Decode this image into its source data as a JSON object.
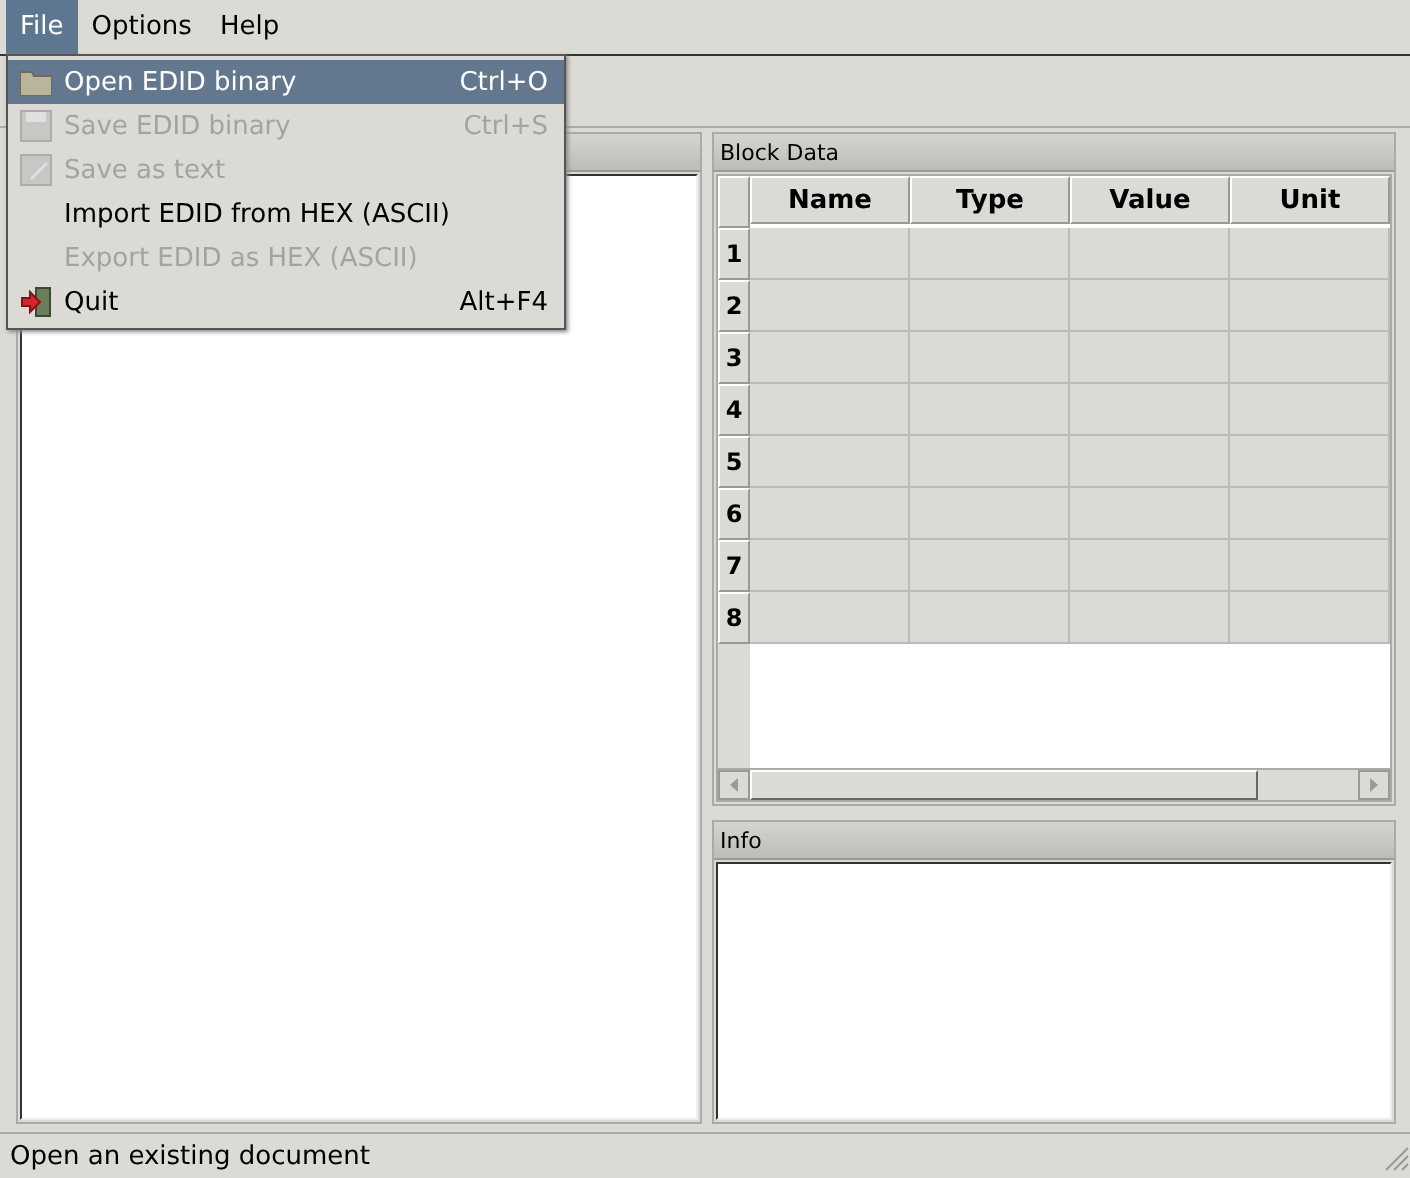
{
  "menubar": [
    {
      "label": "File",
      "selected": true
    },
    {
      "label": "Options",
      "selected": false
    },
    {
      "label": "Help",
      "selected": false
    }
  ],
  "file_menu": [
    {
      "label": "Open EDID binary",
      "shortcut": "Ctrl+O",
      "kind": "folder",
      "disabled": false,
      "selected": true
    },
    {
      "label": "Save EDID binary",
      "shortcut": "Ctrl+S",
      "kind": "save",
      "disabled": true,
      "selected": false
    },
    {
      "label": "Save as text",
      "kind": "save-text",
      "disabled": true,
      "selected": false
    },
    {
      "label": "Import EDID from HEX (ASCII)",
      "kind": "none",
      "disabled": false,
      "selected": false
    },
    {
      "label": "Export EDID as HEX (ASCII)",
      "kind": "none",
      "disabled": true,
      "selected": false
    },
    {
      "label": "Quit",
      "shortcut": "Alt+F4",
      "kind": "quit",
      "disabled": false,
      "selected": false
    }
  ],
  "block_data": {
    "title": "Block Data",
    "columns": [
      "Name",
      "Type",
      "Value",
      "Unit"
    ],
    "row_headers": [
      "1",
      "2",
      "3",
      "4",
      "5",
      "6",
      "7",
      "8"
    ]
  },
  "info": {
    "title": "Info"
  },
  "status_bar": "Open an existing document"
}
